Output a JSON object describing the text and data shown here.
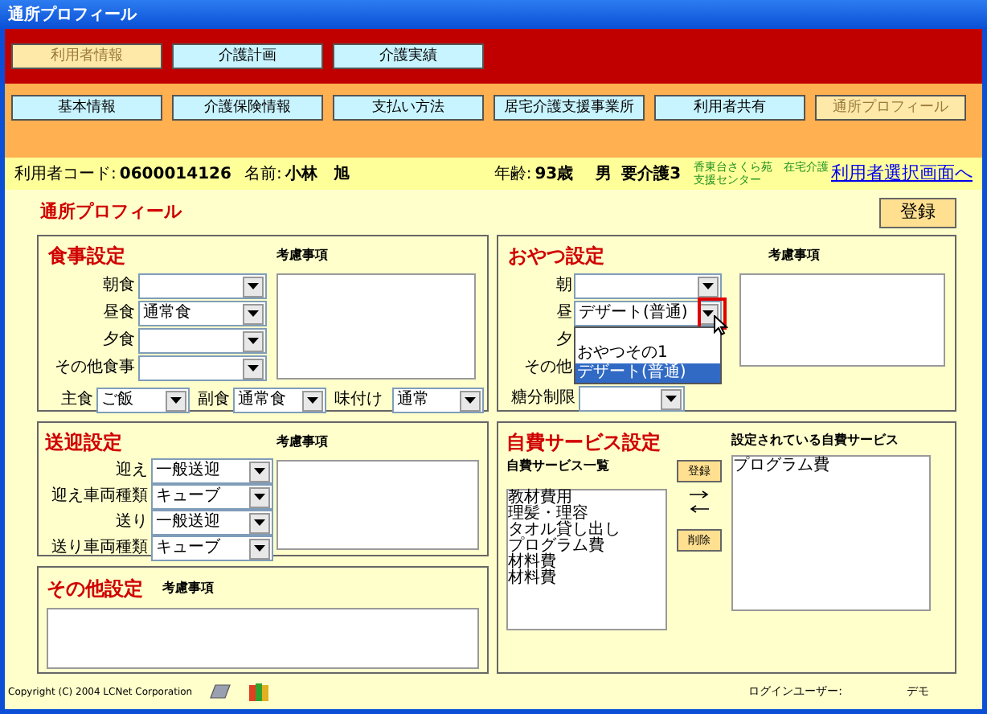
{
  "window": {
    "title": "通所プロフィール"
  },
  "main_tabs": [
    {
      "label": "利用者情報",
      "selected": true
    },
    {
      "label": "介護計画",
      "selected": false
    },
    {
      "label": "介護実績",
      "selected": false
    }
  ],
  "sub_tabs": [
    {
      "label": "基本情報",
      "selected": false
    },
    {
      "label": "介護保険情報",
      "selected": false
    },
    {
      "label": "支払い方法",
      "selected": false
    },
    {
      "label": "居宅介護支援事業所",
      "selected": false
    },
    {
      "label": "利用者共有",
      "selected": false
    },
    {
      "label": "通所プロフィール",
      "selected": true
    }
  ],
  "user_info": {
    "code_label": "利用者コード:",
    "code": "0600014126",
    "name_label": "名前:",
    "name": "小林　旭",
    "age_label": "年齢:",
    "age": "93歳",
    "sex": "男",
    "care_level": "要介護3",
    "office": "香東台さくら苑　在宅介護支援センター",
    "link": "利用者選択画面へ"
  },
  "page_title": "通所プロフィール",
  "register_button": "登録",
  "meal": {
    "title": "食事設定",
    "notes_label": "考慮事項",
    "rows": [
      {
        "label": "朝食",
        "value": ""
      },
      {
        "label": "昼食",
        "value": "通常食"
      },
      {
        "label": "夕食",
        "value": ""
      },
      {
        "label": "その他食事",
        "value": ""
      }
    ],
    "bottom": [
      {
        "label": "主食",
        "value": "ご飯"
      },
      {
        "label": "副食",
        "value": "通常食"
      },
      {
        "label": "味付け",
        "value": "通常"
      }
    ]
  },
  "snack": {
    "title": "おやつ設定",
    "notes_label": "考慮事項",
    "rows": [
      {
        "label": "朝",
        "value": "",
        "expanded": false
      },
      {
        "label": "昼",
        "value": "デザート(普通)",
        "expanded": true
      },
      {
        "label": "夕",
        "value": "",
        "expanded": false
      },
      {
        "label": "その他",
        "value": "",
        "expanded": false
      }
    ],
    "options": [
      {
        "label": "おやつその1",
        "selected": false
      },
      {
        "label": "デザート(普通)",
        "selected": true
      }
    ],
    "sugar": {
      "label": "糖分制限"
    }
  },
  "transport": {
    "title": "送迎設定",
    "notes_label": "考慮事項",
    "rows": [
      {
        "label": "迎え",
        "value": "一般送迎"
      },
      {
        "label": "迎え車両種類",
        "value": "キューブ"
      },
      {
        "label": "送り",
        "value": "一般送迎"
      },
      {
        "label": "送り車両種類",
        "value": "キューブ"
      }
    ]
  },
  "other": {
    "title": "その他設定",
    "notes_label": "考慮事項"
  },
  "self_pay": {
    "title": "自費サービス設定",
    "list_label": "自費サービス一覧",
    "items": [
      "教材費用",
      "理髪・理容",
      "タオル貸し出し",
      "プログラム費",
      "材料費",
      "材料費"
    ],
    "add_button": "登録",
    "remove_button": "削除",
    "assigned_label": "設定されている自費サービス",
    "assigned": [
      "プログラム費"
    ]
  },
  "footer": {
    "copyright": "Copyright (C) 2004 LCNet Corporation",
    "login_label": "ログインユーザー:",
    "login_user": "デモ"
  }
}
